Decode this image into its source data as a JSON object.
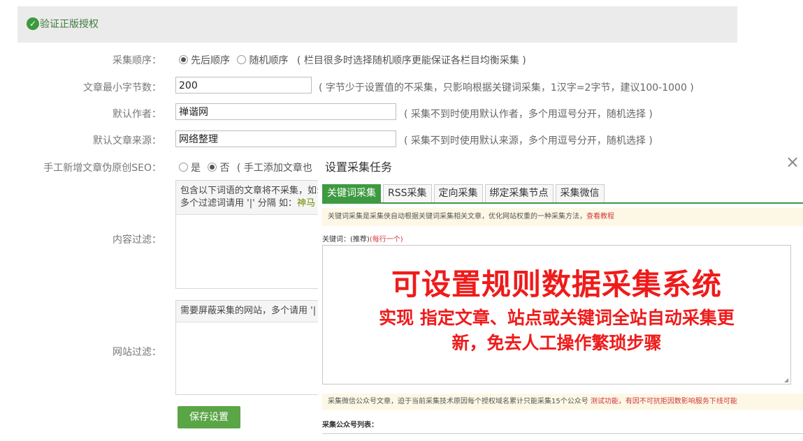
{
  "header": {
    "title": "验证正版授权"
  },
  "form": {
    "order": {
      "label": "采集顺序：",
      "opt1": "先后顺序",
      "opt2": "随机顺序",
      "hint": "( 栏目很多时选择随机顺序更能保证各栏目均衡采集 )"
    },
    "min_bytes": {
      "label": "文章最小字节数：",
      "value": "200",
      "hint": "( 字节少于设置值的不采集，只影响根据关键词采集，1汉字=2字节，建议100-1000 )"
    },
    "author": {
      "label": "默认作者：",
      "value": "禅谐网",
      "hint": "( 采集不到时使用默认作者，多个用逗号分开，随机选择 )"
    },
    "source": {
      "label": "默认文章来源：",
      "value": "网络整理",
      "hint": "( 采集不到时使用默认来源，多个用逗号分开，随机选择 )"
    },
    "seo": {
      "label": "手工新增文章伪原创SEO：",
      "opt1": "是",
      "opt2": "否",
      "hint": "( 手工添加文章也"
    },
    "content_filter": {
      "label": "内容过滤：",
      "line1": "包含以下词语的文章将不采集，如:",
      "line2a": "多个过滤词请用 '|' 分隔 如：",
      "line2b": "神马"
    },
    "site_filter": {
      "label": "网站过滤：",
      "line1": "需要屏蔽采集的网站，多个请用 '|"
    },
    "save_label": "保存设置"
  },
  "modal": {
    "title": "设置采集任务",
    "close": "×",
    "tabs": [
      "关键词采集",
      "RSS采集",
      "定向采集",
      "绑定采集节点",
      "采集微信"
    ],
    "notice": "关键词采集是采集侠自动根据关键词采集相关文章，优化网站权重的一种采集方法，",
    "notice_link": "查看教程",
    "kw_label": "关键词：(推荐)",
    "kw_red": "(每行一个)",
    "promo1": "可设置规则数据采集系统",
    "promo2": "实现 指定文章、站点或关键词全站自动采集更",
    "promo3": "新，免去人工操作繁琐步骤",
    "notice2": "采集微信公众号文章，迫于当前采集技术原因每个授权域名累计只能采集15个公众号 ",
    "notice2_red": "测试功能，有因不可抗拒因数影响服务下线可能",
    "wx_label": "采集公众号列表："
  }
}
